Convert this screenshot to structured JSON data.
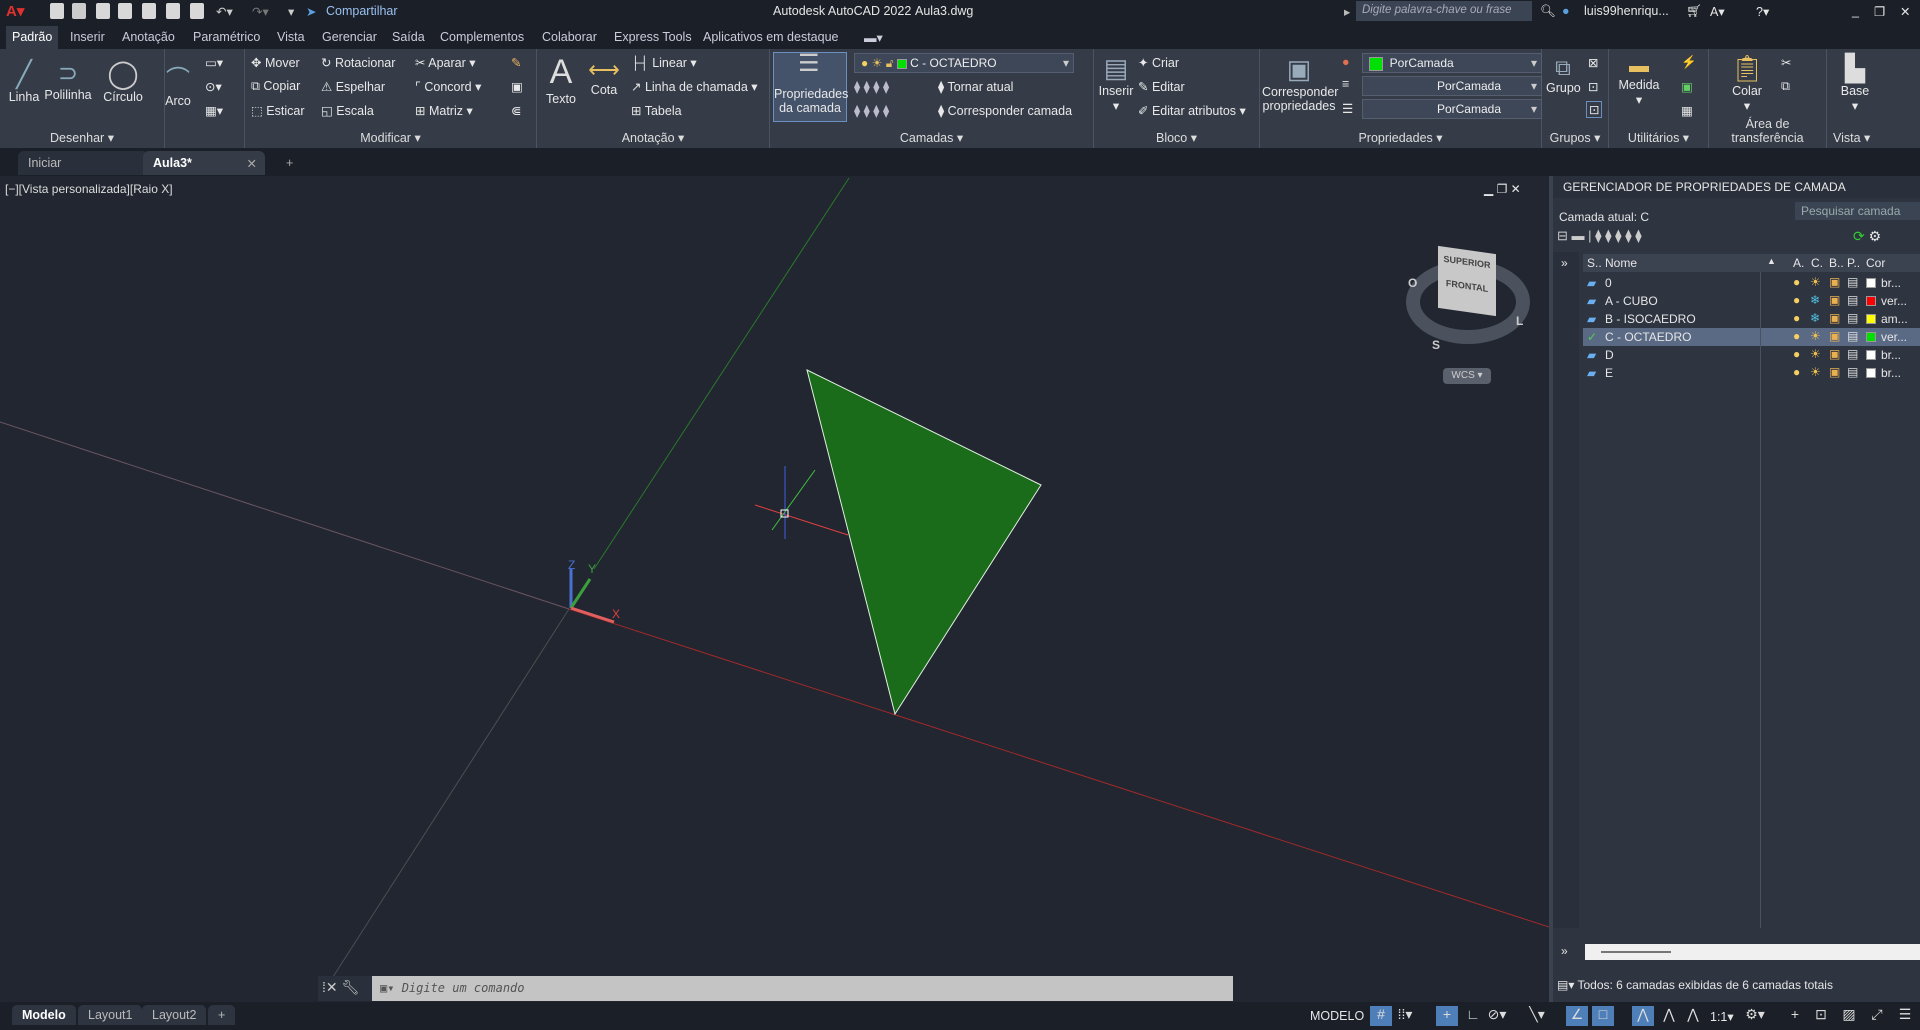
{
  "title": {
    "app": "Autodesk AutoCAD 2022",
    "file": "Aula3.dwg",
    "share": "Compartilhar",
    "search_placeholder": "Digite palavra-chave ou frase",
    "user": "luis99henriqu..."
  },
  "ribbon_tabs": [
    "Padrão",
    "Inserir",
    "Anotação",
    "Paramétrico",
    "Vista",
    "Gerenciar",
    "Saída",
    "Complementos",
    "Colaborar",
    "Express Tools",
    "Aplicativos em destaque"
  ],
  "panels": {
    "desenhar": {
      "title": "Desenhar ▾",
      "items": [
        "Linha",
        "Polilinha",
        "Círculo",
        "Arco"
      ]
    },
    "modificar": {
      "title": "Modificar ▾",
      "items": [
        "Mover",
        "Rotacionar",
        "Aparar",
        "Copiar",
        "Espelhar",
        "Concord",
        "Esticar",
        "Escala",
        "Matriz"
      ]
    },
    "anotacao": {
      "title": "Anotação ▾",
      "items": [
        "Texto",
        "Cota",
        "Linear",
        "Linha de chamada",
        "Tabela"
      ]
    },
    "camadas": {
      "title": "Camadas ▾",
      "big": "Propriedades da camada",
      "current": "C - OCTAEDRO",
      "items": [
        "Tornar atual",
        "Corresponder camada"
      ]
    },
    "bloco": {
      "title": "Bloco ▾",
      "items": [
        "Inserir",
        "Criar",
        "Editar",
        "Editar atributos"
      ]
    },
    "propriedades": {
      "title": "Propriedades ▾",
      "big": "Corresponder propriedades",
      "color": "PorCamada",
      "linetype": "PorCamada",
      "lineweight": "PorCamada"
    },
    "grupos": {
      "title": "Grupos ▾",
      "item": "Grupo"
    },
    "utilitarios": {
      "title": "Utilitários ▾",
      "item": "Medida"
    },
    "transferencia": {
      "title": "Área de transferência",
      "item": "Colar"
    },
    "vista": {
      "title": "Vista ▾",
      "item": "Base"
    }
  },
  "doc_tabs": [
    "Iniciar",
    "Aula3*"
  ],
  "viewport": {
    "label": "[−][Vista personalizada][Raio X]",
    "viewcube": {
      "top": "SUPERIOR",
      "front": "FRONTAL",
      "compass": [
        "O",
        "S",
        "L"
      ],
      "ucs": "WCS"
    },
    "ucs_axes": [
      "Z",
      "Y",
      "X"
    ],
    "shape_color": "#1a6b1a"
  },
  "layer_panel": {
    "title": "GERENCIADOR DE PROPRIEDADES DE CAMADA",
    "current": "Camada atual: C",
    "search_placeholder": "Pesquisar camada",
    "columns": [
      "S..",
      "Nome",
      "A.",
      "C.",
      "B..",
      "P..",
      "Cor"
    ],
    "layers": [
      {
        "name": "0",
        "color": "#ffffff",
        "color_name": "br...",
        "frozen": false,
        "current": false
      },
      {
        "name": "A - CUBO",
        "color": "#ff0000",
        "color_name": "ver...",
        "frozen": true,
        "current": false
      },
      {
        "name": "B - ISOCAEDRO",
        "color": "#ffff00",
        "color_name": "am...",
        "frozen": true,
        "current": false
      },
      {
        "name": "C - OCTAEDRO",
        "color": "#00e000",
        "color_name": "ver...",
        "frozen": false,
        "current": true
      },
      {
        "name": "D",
        "color": "#ffffff",
        "color_name": "br...",
        "frozen": false,
        "current": false
      },
      {
        "name": "E",
        "color": "#ffffff",
        "color_name": "br...",
        "frozen": false,
        "current": false
      }
    ],
    "footer": "Todos: 6 camadas exibidas de 6 camadas totais"
  },
  "command": {
    "placeholder": "Digite um comando"
  },
  "layout_tabs": [
    "Modelo",
    "Layout1",
    "Layout2"
  ],
  "status": {
    "mode": "MODELO",
    "scale": "1:1"
  }
}
